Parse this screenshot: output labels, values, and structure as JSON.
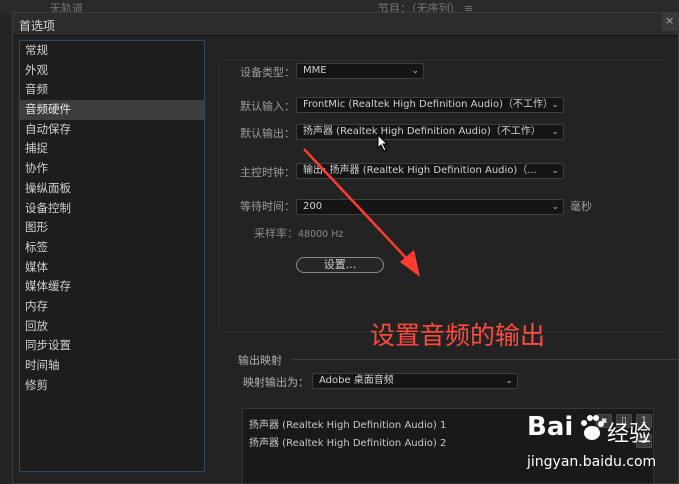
{
  "background_app": {
    "tab_left": "无轨道",
    "tab_right": "节目：（无序列） ≡"
  },
  "dialog": {
    "title": "首选项",
    "close_glyph": "×"
  },
  "sidebar": {
    "selected_index": 3,
    "items": [
      {
        "label": "常规"
      },
      {
        "label": "外观"
      },
      {
        "label": "音频"
      },
      {
        "label": "音频硬件"
      },
      {
        "label": "自动保存"
      },
      {
        "label": "捕捉"
      },
      {
        "label": "协作"
      },
      {
        "label": "操纵面板"
      },
      {
        "label": "设备控制"
      },
      {
        "label": "图形"
      },
      {
        "label": "标签"
      },
      {
        "label": "媒体"
      },
      {
        "label": "媒体缓存"
      },
      {
        "label": "内存"
      },
      {
        "label": "回放"
      },
      {
        "label": "同步设置"
      },
      {
        "label": "时间轴"
      },
      {
        "label": "修剪"
      }
    ]
  },
  "audio_hardware": {
    "device_type_label": "设备类型：",
    "device_type_value": "MME",
    "default_input_label": "默认输入：",
    "default_input_value": "FrontMic (Realtek High Definition Audio)（不工作）",
    "default_output_label": "默认输出：",
    "default_output_value": "扬声器 (Realtek High Definition Audio)（不工作）",
    "master_clock_label": "主控时钟：",
    "master_clock_value": "输出: 扬声器 (Realtek High Definition Audio)（...",
    "latency_label": "等待时间：",
    "latency_value": "200",
    "latency_unit": "毫秒",
    "sample_rate_label": "采样率：",
    "sample_rate_value": "48000 Hz",
    "settings_button": "设置..."
  },
  "output_mapping": {
    "section_label": "输出映射",
    "map_output_label": "映射输出为：",
    "map_output_value": "Adobe 桌面音频",
    "channels": [
      {
        "label": "扬声器 (Realtek High Definition Audio) 1"
      },
      {
        "label": "扬声器 (Realtek High Definition Audio) 2"
      }
    ],
    "channel_numbers": [
      "1",
      "2"
    ]
  },
  "annotation": {
    "text": "设置音频的输出",
    "color": "#ff4a3d"
  },
  "watermark": {
    "brand": "Bai",
    "brand_suffix": "经验",
    "url": "jingyan.baidu.com"
  },
  "icons": {
    "chevron": "chevron-down-icon",
    "cursor": "mouse-cursor-icon",
    "arrow": "annotation-arrow-icon",
    "paw": "baidu-paw-icon"
  }
}
